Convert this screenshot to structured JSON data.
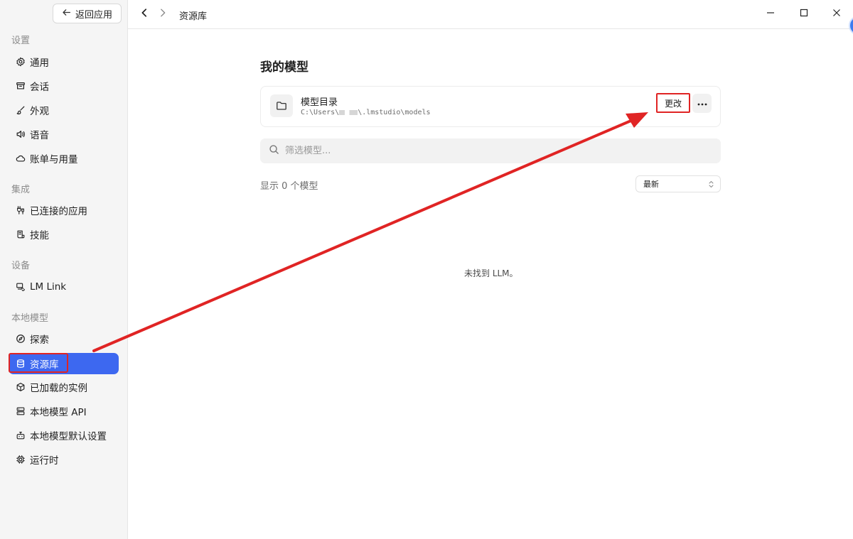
{
  "sidebar": {
    "back_label": "返回应用",
    "sections": {
      "settings": "设置",
      "integrations": "集成",
      "devices": "设备",
      "local_models": "本地模型"
    },
    "items": {
      "general": "通用",
      "sessions": "会话",
      "appearance": "外观",
      "voice": "语音",
      "billing": "账单与用量",
      "connected_apps": "已连接的应用",
      "skills": "技能",
      "lm_link": "LM Link",
      "explore": "探索",
      "library": "资源库",
      "loaded_instances": "已加载的实例",
      "local_api": "本地模型 API",
      "model_defaults": "本地模型默认设置",
      "runtime": "运行时"
    },
    "active_item": "library"
  },
  "topbar": {
    "breadcrumb": "资源库"
  },
  "main": {
    "title": "我的模型",
    "directory": {
      "label": "模型目录",
      "path_prefix": "C:\\Users\\",
      "path_suffix": "\\.lmstudio\\models",
      "change_label": "更改"
    },
    "filter_placeholder": "筛选模型...",
    "count_text": "显示 0 个模型",
    "sort_value": "最新",
    "empty_text": "未找到 LLM。"
  },
  "colors": {
    "accent": "#3d68f0",
    "annotation": "#e02424"
  }
}
